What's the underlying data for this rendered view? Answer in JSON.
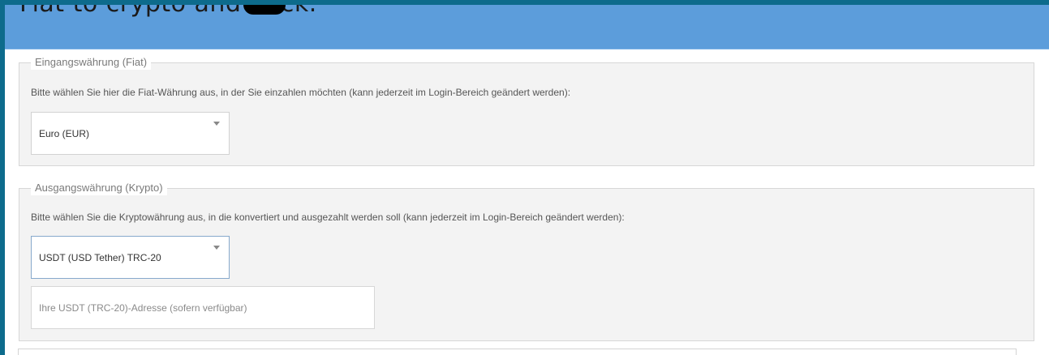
{
  "header": {
    "title": "Fiat to crypto and back."
  },
  "fiat_section": {
    "legend": "Eingangswährung (Fiat)",
    "description": "Bitte wählen Sie hier die Fiat-Währung aus, in der Sie einzahlen möchten (kann jederzeit im Login-Bereich geändert werden):",
    "selected_currency": "Euro (EUR)"
  },
  "crypto_section": {
    "legend": "Ausgangswährung (Krypto)",
    "description": "Bitte wählen Sie die Kryptowährung aus, in die konvertiert und ausgezahlt werden soll (kann jederzeit im Login-Bereich geändert werden):",
    "selected_currency": "USDT (USD Tether) TRC-20",
    "address_placeholder": "Ihre USDT (TRC-20)-Adresse (sofern verfügbar)"
  },
  "colors": {
    "outer_border": "#0d6b8c",
    "header_background": "#5c9ddb",
    "section_background": "#f3f3f3",
    "active_select_border": "#87a9cc"
  }
}
